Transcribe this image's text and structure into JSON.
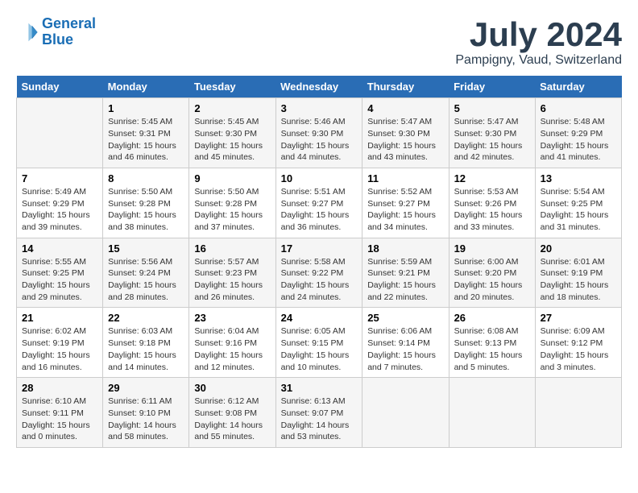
{
  "header": {
    "logo_line1": "General",
    "logo_line2": "Blue",
    "title": "July 2024",
    "subtitle": "Pampigny, Vaud, Switzerland"
  },
  "days_of_week": [
    "Sunday",
    "Monday",
    "Tuesday",
    "Wednesday",
    "Thursday",
    "Friday",
    "Saturday"
  ],
  "weeks": [
    [
      {
        "day": "",
        "info": ""
      },
      {
        "day": "1",
        "info": "Sunrise: 5:45 AM\nSunset: 9:31 PM\nDaylight: 15 hours\nand 46 minutes."
      },
      {
        "day": "2",
        "info": "Sunrise: 5:45 AM\nSunset: 9:30 PM\nDaylight: 15 hours\nand 45 minutes."
      },
      {
        "day": "3",
        "info": "Sunrise: 5:46 AM\nSunset: 9:30 PM\nDaylight: 15 hours\nand 44 minutes."
      },
      {
        "day": "4",
        "info": "Sunrise: 5:47 AM\nSunset: 9:30 PM\nDaylight: 15 hours\nand 43 minutes."
      },
      {
        "day": "5",
        "info": "Sunrise: 5:47 AM\nSunset: 9:30 PM\nDaylight: 15 hours\nand 42 minutes."
      },
      {
        "day": "6",
        "info": "Sunrise: 5:48 AM\nSunset: 9:29 PM\nDaylight: 15 hours\nand 41 minutes."
      }
    ],
    [
      {
        "day": "7",
        "info": "Sunrise: 5:49 AM\nSunset: 9:29 PM\nDaylight: 15 hours\nand 39 minutes."
      },
      {
        "day": "8",
        "info": "Sunrise: 5:50 AM\nSunset: 9:28 PM\nDaylight: 15 hours\nand 38 minutes."
      },
      {
        "day": "9",
        "info": "Sunrise: 5:50 AM\nSunset: 9:28 PM\nDaylight: 15 hours\nand 37 minutes."
      },
      {
        "day": "10",
        "info": "Sunrise: 5:51 AM\nSunset: 9:27 PM\nDaylight: 15 hours\nand 36 minutes."
      },
      {
        "day": "11",
        "info": "Sunrise: 5:52 AM\nSunset: 9:27 PM\nDaylight: 15 hours\nand 34 minutes."
      },
      {
        "day": "12",
        "info": "Sunrise: 5:53 AM\nSunset: 9:26 PM\nDaylight: 15 hours\nand 33 minutes."
      },
      {
        "day": "13",
        "info": "Sunrise: 5:54 AM\nSunset: 9:25 PM\nDaylight: 15 hours\nand 31 minutes."
      }
    ],
    [
      {
        "day": "14",
        "info": "Sunrise: 5:55 AM\nSunset: 9:25 PM\nDaylight: 15 hours\nand 29 minutes."
      },
      {
        "day": "15",
        "info": "Sunrise: 5:56 AM\nSunset: 9:24 PM\nDaylight: 15 hours\nand 28 minutes."
      },
      {
        "day": "16",
        "info": "Sunrise: 5:57 AM\nSunset: 9:23 PM\nDaylight: 15 hours\nand 26 minutes."
      },
      {
        "day": "17",
        "info": "Sunrise: 5:58 AM\nSunset: 9:22 PM\nDaylight: 15 hours\nand 24 minutes."
      },
      {
        "day": "18",
        "info": "Sunrise: 5:59 AM\nSunset: 9:21 PM\nDaylight: 15 hours\nand 22 minutes."
      },
      {
        "day": "19",
        "info": "Sunrise: 6:00 AM\nSunset: 9:20 PM\nDaylight: 15 hours\nand 20 minutes."
      },
      {
        "day": "20",
        "info": "Sunrise: 6:01 AM\nSunset: 9:19 PM\nDaylight: 15 hours\nand 18 minutes."
      }
    ],
    [
      {
        "day": "21",
        "info": "Sunrise: 6:02 AM\nSunset: 9:19 PM\nDaylight: 15 hours\nand 16 minutes."
      },
      {
        "day": "22",
        "info": "Sunrise: 6:03 AM\nSunset: 9:18 PM\nDaylight: 15 hours\nand 14 minutes."
      },
      {
        "day": "23",
        "info": "Sunrise: 6:04 AM\nSunset: 9:16 PM\nDaylight: 15 hours\nand 12 minutes."
      },
      {
        "day": "24",
        "info": "Sunrise: 6:05 AM\nSunset: 9:15 PM\nDaylight: 15 hours\nand 10 minutes."
      },
      {
        "day": "25",
        "info": "Sunrise: 6:06 AM\nSunset: 9:14 PM\nDaylight: 15 hours\nand 7 minutes."
      },
      {
        "day": "26",
        "info": "Sunrise: 6:08 AM\nSunset: 9:13 PM\nDaylight: 15 hours\nand 5 minutes."
      },
      {
        "day": "27",
        "info": "Sunrise: 6:09 AM\nSunset: 9:12 PM\nDaylight: 15 hours\nand 3 minutes."
      }
    ],
    [
      {
        "day": "28",
        "info": "Sunrise: 6:10 AM\nSunset: 9:11 PM\nDaylight: 15 hours\nand 0 minutes."
      },
      {
        "day": "29",
        "info": "Sunrise: 6:11 AM\nSunset: 9:10 PM\nDaylight: 14 hours\nand 58 minutes."
      },
      {
        "day": "30",
        "info": "Sunrise: 6:12 AM\nSunset: 9:08 PM\nDaylight: 14 hours\nand 55 minutes."
      },
      {
        "day": "31",
        "info": "Sunrise: 6:13 AM\nSunset: 9:07 PM\nDaylight: 14 hours\nand 53 minutes."
      },
      {
        "day": "",
        "info": ""
      },
      {
        "day": "",
        "info": ""
      },
      {
        "day": "",
        "info": ""
      }
    ]
  ]
}
